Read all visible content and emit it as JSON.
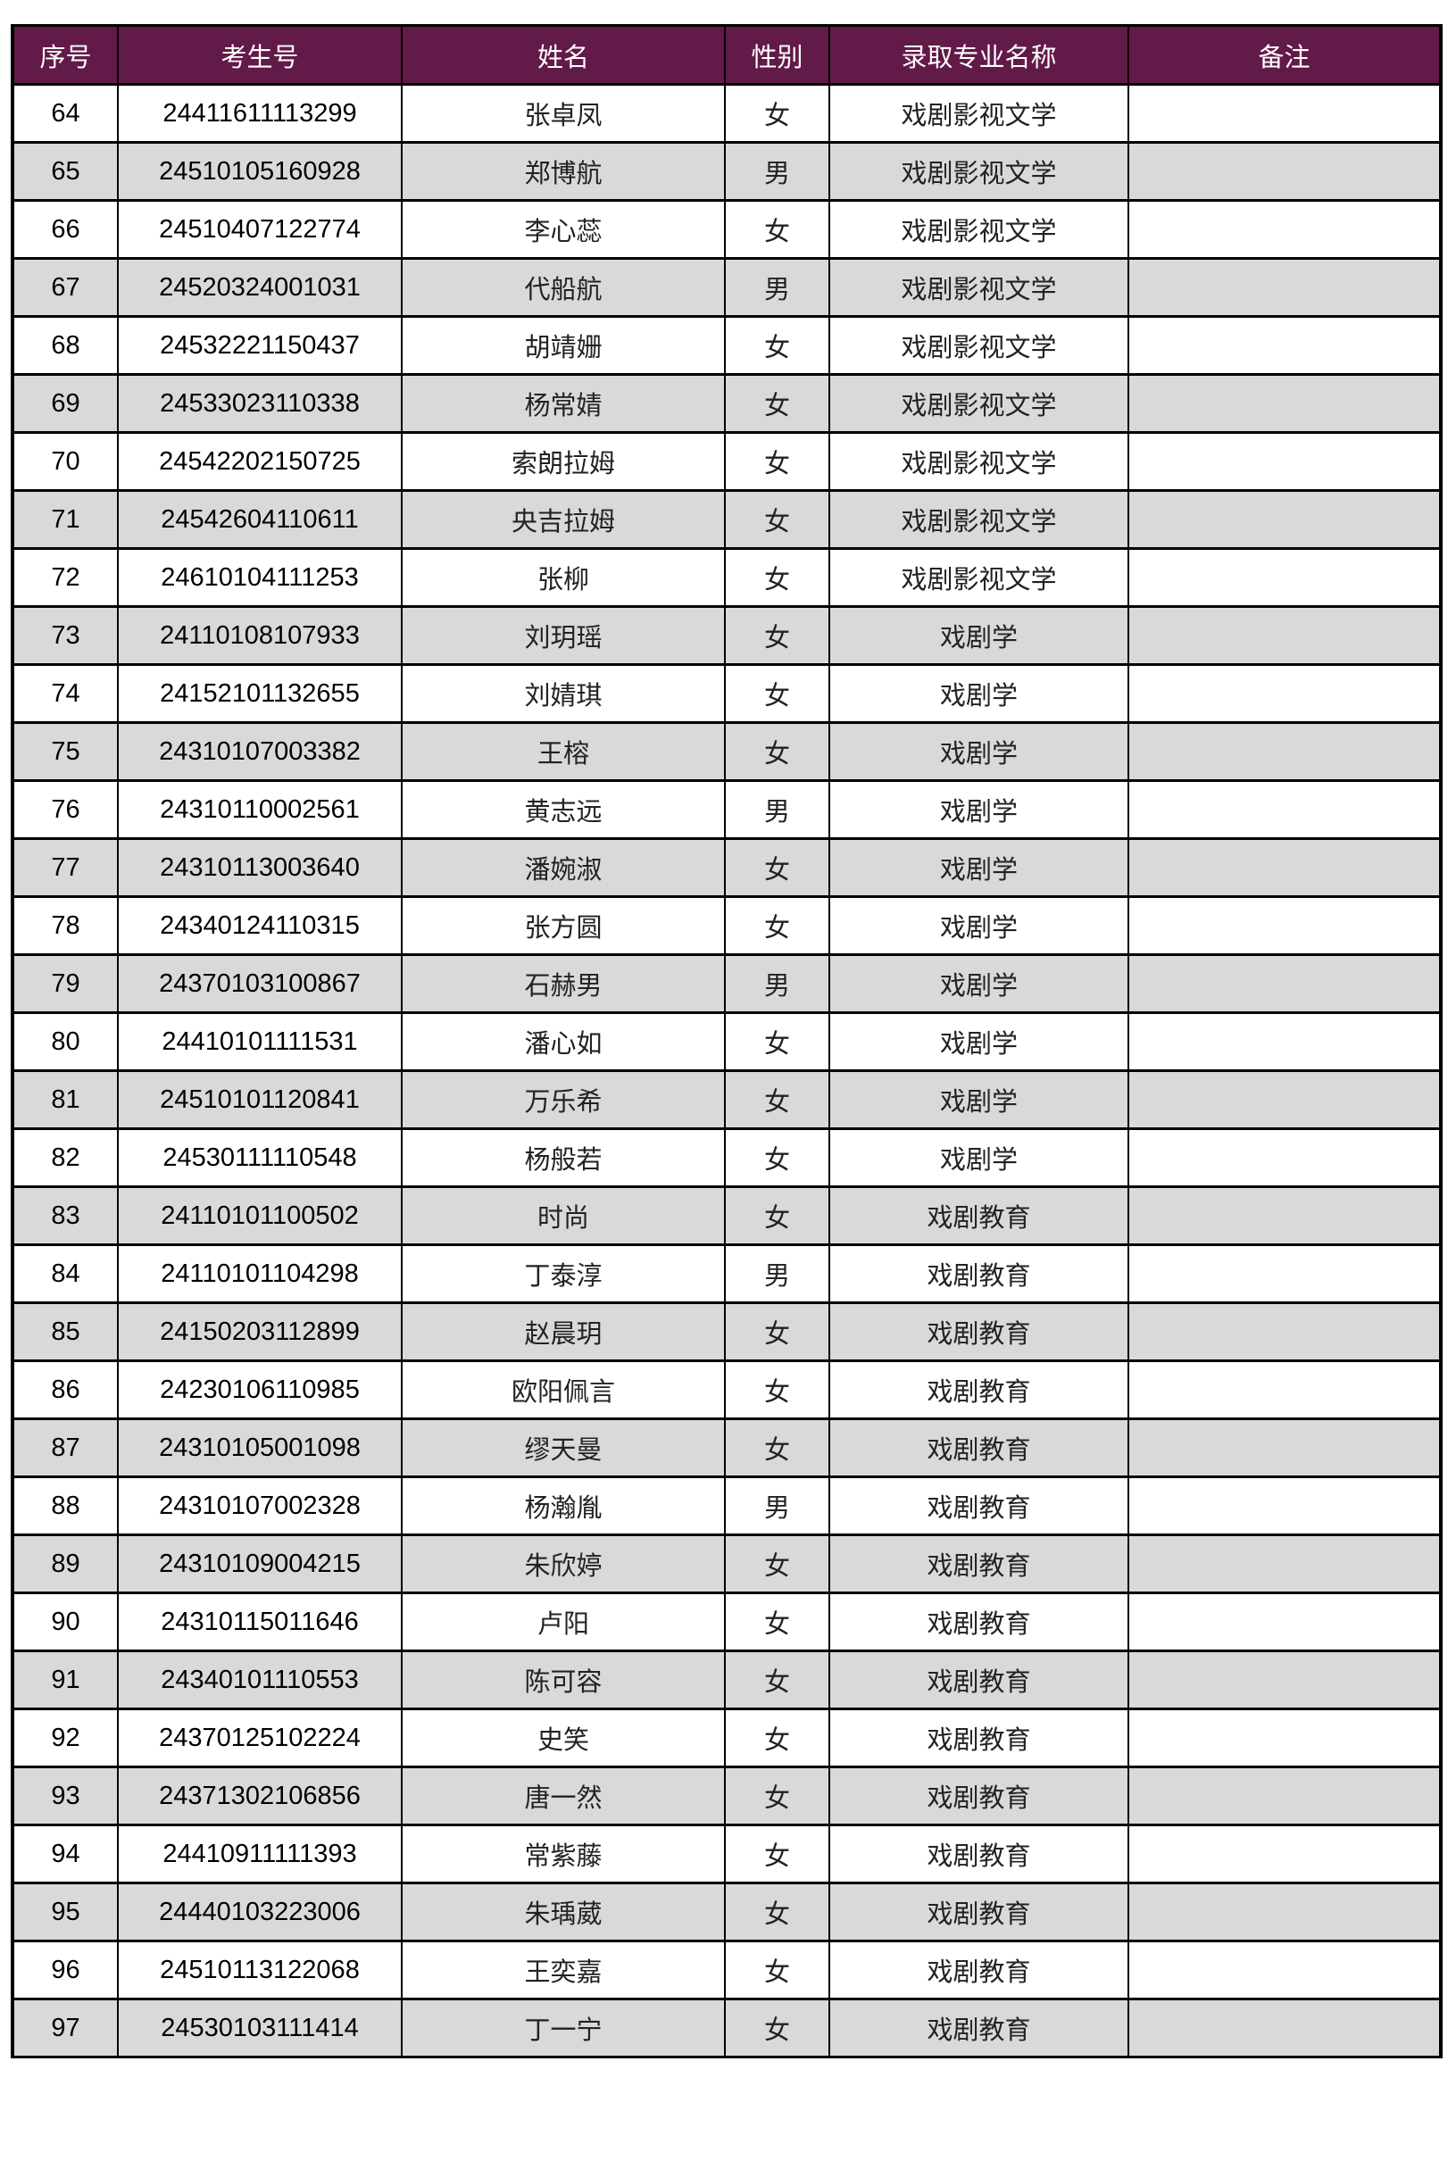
{
  "table": {
    "headers": [
      "序号",
      "考生号",
      "姓名",
      "性别",
      "录取专业名称",
      "备注"
    ],
    "rows": [
      {
        "idx": "64",
        "exam_no": "24411611113299",
        "name": "张卓凤",
        "sex": "女",
        "major": "戏剧影视文学",
        "note": ""
      },
      {
        "idx": "65",
        "exam_no": "24510105160928",
        "name": "郑博航",
        "sex": "男",
        "major": "戏剧影视文学",
        "note": ""
      },
      {
        "idx": "66",
        "exam_no": "24510407122774",
        "name": "李心蕊",
        "sex": "女",
        "major": "戏剧影视文学",
        "note": ""
      },
      {
        "idx": "67",
        "exam_no": "24520324001031",
        "name": "代船航",
        "sex": "男",
        "major": "戏剧影视文学",
        "note": ""
      },
      {
        "idx": "68",
        "exam_no": "24532221150437",
        "name": "胡靖姗",
        "sex": "女",
        "major": "戏剧影视文学",
        "note": ""
      },
      {
        "idx": "69",
        "exam_no": "24533023110338",
        "name": "杨常婧",
        "sex": "女",
        "major": "戏剧影视文学",
        "note": ""
      },
      {
        "idx": "70",
        "exam_no": "24542202150725",
        "name": "索朗拉姆",
        "sex": "女",
        "major": "戏剧影视文学",
        "note": ""
      },
      {
        "idx": "71",
        "exam_no": "24542604110611",
        "name": "央吉拉姆",
        "sex": "女",
        "major": "戏剧影视文学",
        "note": ""
      },
      {
        "idx": "72",
        "exam_no": "24610104111253",
        "name": "张柳",
        "sex": "女",
        "major": "戏剧影视文学",
        "note": ""
      },
      {
        "idx": "73",
        "exam_no": "24110108107933",
        "name": "刘玥瑶",
        "sex": "女",
        "major": "戏剧学",
        "note": ""
      },
      {
        "idx": "74",
        "exam_no": "24152101132655",
        "name": "刘婧琪",
        "sex": "女",
        "major": "戏剧学",
        "note": ""
      },
      {
        "idx": "75",
        "exam_no": "24310107003382",
        "name": "王榕",
        "sex": "女",
        "major": "戏剧学",
        "note": ""
      },
      {
        "idx": "76",
        "exam_no": "24310110002561",
        "name": "黄志远",
        "sex": "男",
        "major": "戏剧学",
        "note": ""
      },
      {
        "idx": "77",
        "exam_no": "24310113003640",
        "name": "潘婉淑",
        "sex": "女",
        "major": "戏剧学",
        "note": ""
      },
      {
        "idx": "78",
        "exam_no": "24340124110315",
        "name": "张方圆",
        "sex": "女",
        "major": "戏剧学",
        "note": ""
      },
      {
        "idx": "79",
        "exam_no": "24370103100867",
        "name": "石赫男",
        "sex": "男",
        "major": "戏剧学",
        "note": ""
      },
      {
        "idx": "80",
        "exam_no": "24410101111531",
        "name": "潘心如",
        "sex": "女",
        "major": "戏剧学",
        "note": ""
      },
      {
        "idx": "81",
        "exam_no": "24510101120841",
        "name": "万乐希",
        "sex": "女",
        "major": "戏剧学",
        "note": ""
      },
      {
        "idx": "82",
        "exam_no": "24530111110548",
        "name": "杨般若",
        "sex": "女",
        "major": "戏剧学",
        "note": ""
      },
      {
        "idx": "83",
        "exam_no": "24110101100502",
        "name": "时尚",
        "sex": "女",
        "major": "戏剧教育",
        "note": ""
      },
      {
        "idx": "84",
        "exam_no": "24110101104298",
        "name": "丁泰淳",
        "sex": "男",
        "major": "戏剧教育",
        "note": ""
      },
      {
        "idx": "85",
        "exam_no": "24150203112899",
        "name": "赵晨玥",
        "sex": "女",
        "major": "戏剧教育",
        "note": ""
      },
      {
        "idx": "86",
        "exam_no": "24230106110985",
        "name": "欧阳佩言",
        "sex": "女",
        "major": "戏剧教育",
        "note": ""
      },
      {
        "idx": "87",
        "exam_no": "24310105001098",
        "name": "缪天曼",
        "sex": "女",
        "major": "戏剧教育",
        "note": ""
      },
      {
        "idx": "88",
        "exam_no": "24310107002328",
        "name": "杨瀚胤",
        "sex": "男",
        "major": "戏剧教育",
        "note": ""
      },
      {
        "idx": "89",
        "exam_no": "24310109004215",
        "name": "朱欣婷",
        "sex": "女",
        "major": "戏剧教育",
        "note": ""
      },
      {
        "idx": "90",
        "exam_no": "24310115011646",
        "name": "卢阳",
        "sex": "女",
        "major": "戏剧教育",
        "note": ""
      },
      {
        "idx": "91",
        "exam_no": "24340101110553",
        "name": "陈可容",
        "sex": "女",
        "major": "戏剧教育",
        "note": ""
      },
      {
        "idx": "92",
        "exam_no": "24370125102224",
        "name": "史笑",
        "sex": "女",
        "major": "戏剧教育",
        "note": ""
      },
      {
        "idx": "93",
        "exam_no": "24371302106856",
        "name": "唐一然",
        "sex": "女",
        "major": "戏剧教育",
        "note": ""
      },
      {
        "idx": "94",
        "exam_no": "24410911111393",
        "name": "常紫藤",
        "sex": "女",
        "major": "戏剧教育",
        "note": ""
      },
      {
        "idx": "95",
        "exam_no": "24440103223006",
        "name": "朱瑀葳",
        "sex": "女",
        "major": "戏剧教育",
        "note": ""
      },
      {
        "idx": "96",
        "exam_no": "24510113122068",
        "name": "王奕嘉",
        "sex": "女",
        "major": "戏剧教育",
        "note": ""
      },
      {
        "idx": "97",
        "exam_no": "24530103111414",
        "name": "丁一宁",
        "sex": "女",
        "major": "戏剧教育",
        "note": ""
      }
    ]
  },
  "colors": {
    "header_bg": "#621a48",
    "header_text": "#ffffff",
    "row_alt_bg": "#d9d9d9",
    "row_bg": "#ffffff",
    "border": "#000000"
  }
}
